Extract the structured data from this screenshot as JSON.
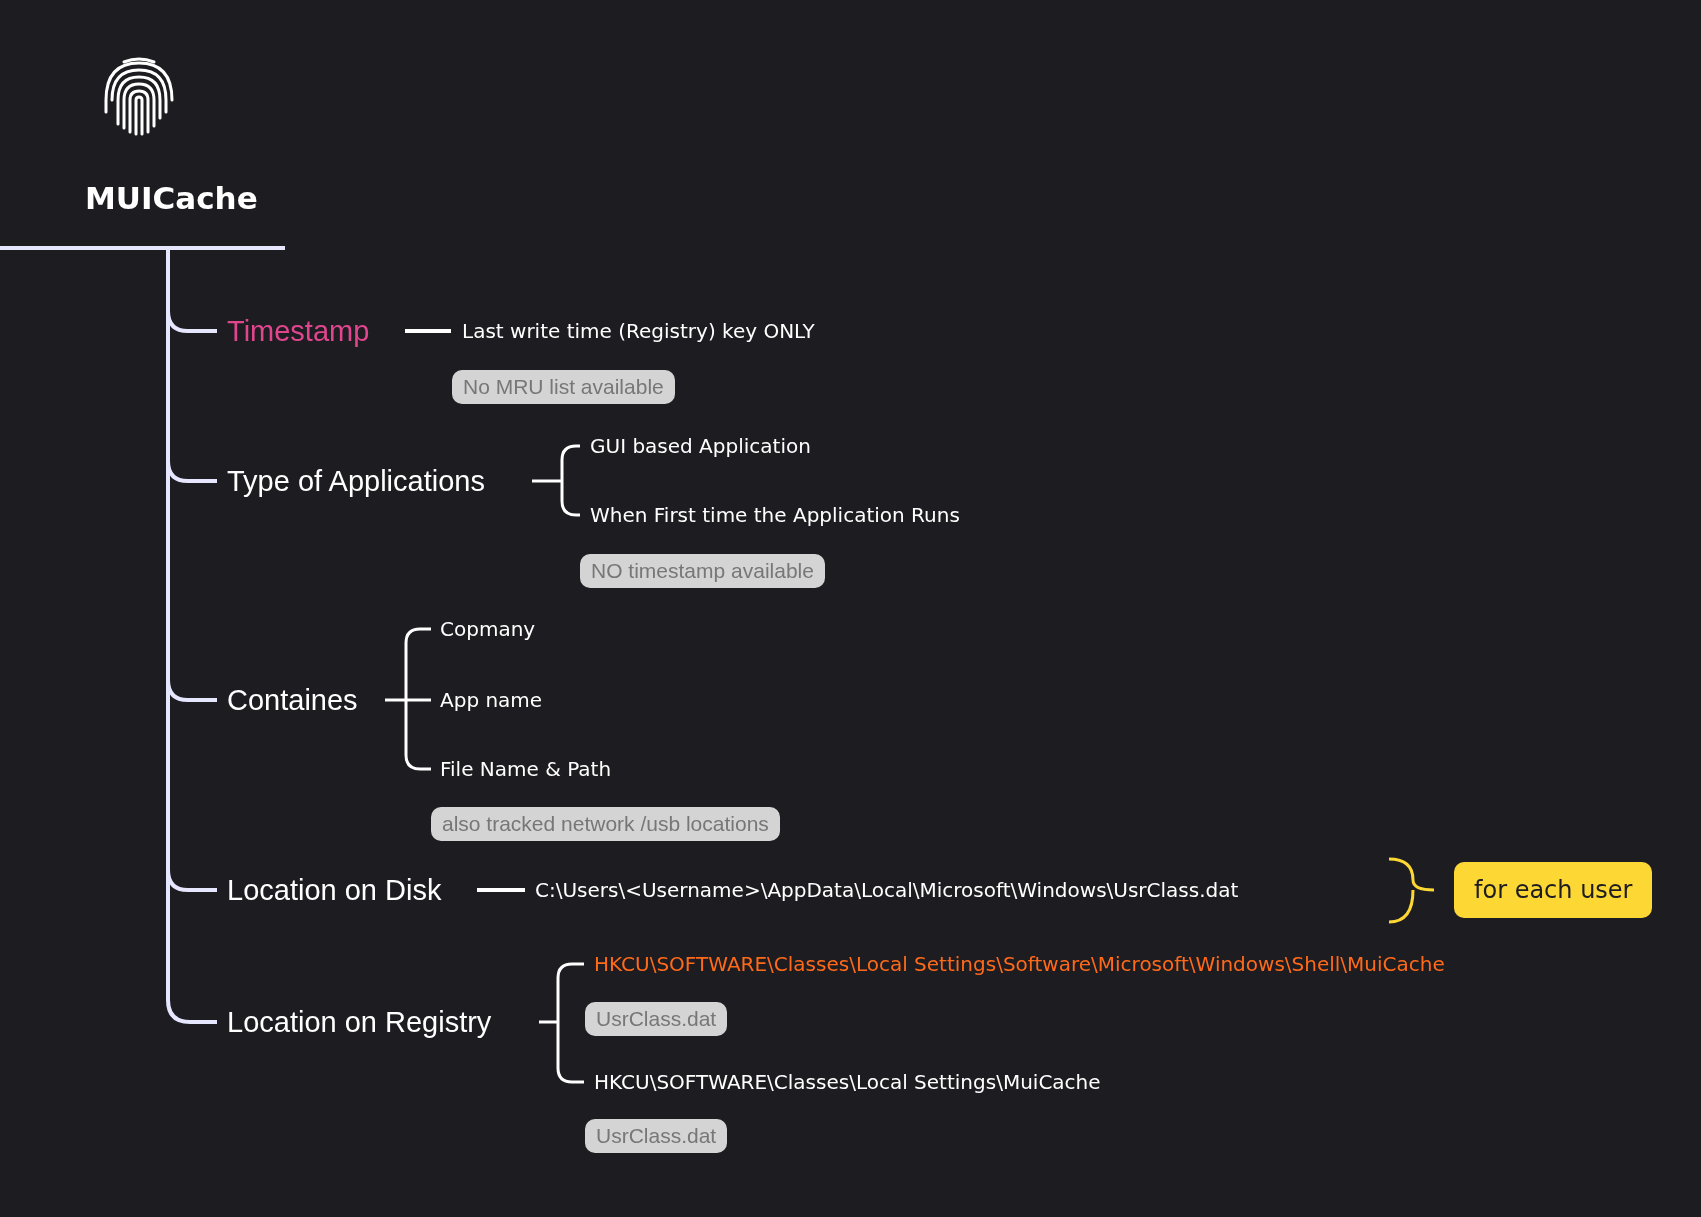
{
  "root": {
    "title": "MUICache"
  },
  "branches": [
    {
      "label": "Timestamp",
      "color": "#e0468e",
      "children": [
        {
          "text": "Last write time (Registry) key ONLY",
          "color": "#ffffff"
        }
      ],
      "note": "No MRU list available"
    },
    {
      "label": "Type of Applications",
      "color": "#ffffff",
      "children": [
        {
          "text": "GUI based Application",
          "color": "#ffffff"
        },
        {
          "text": "When First time the Application Runs",
          "color": "#ffffff"
        }
      ],
      "note": "NO timestamp available"
    },
    {
      "label": "Containes",
      "color": "#ffffff",
      "children": [
        {
          "text": "Copmany",
          "color": "#ffffff"
        },
        {
          "text": "App name",
          "color": "#ffffff"
        },
        {
          "text": "File Name & Path",
          "color": "#ffffff"
        }
      ],
      "note": "also tracked network /usb locations"
    },
    {
      "label": "Location on Disk",
      "color": "#ffffff",
      "children": [
        {
          "text": "C:\\Users\\<Username>\\AppData\\Local\\Microsoft\\Windows\\UsrClass.dat",
          "color": "#ffffff"
        }
      ],
      "summary": "for each user"
    },
    {
      "label": "Location on Registry",
      "color": "#ffffff",
      "children": [
        {
          "text": "HKCU\\SOFTWARE\\Classes\\Local Settings\\Software\\Microsoft\\Windows\\Shell\\MuiCache",
          "color": "#ff6a1a",
          "note": "UsrClass.dat"
        },
        {
          "text": "HKCU\\SOFTWARE\\Classes\\Local Settings\\MuiCache",
          "color": "#ffffff",
          "note": "UsrClass.dat"
        }
      ]
    }
  ]
}
